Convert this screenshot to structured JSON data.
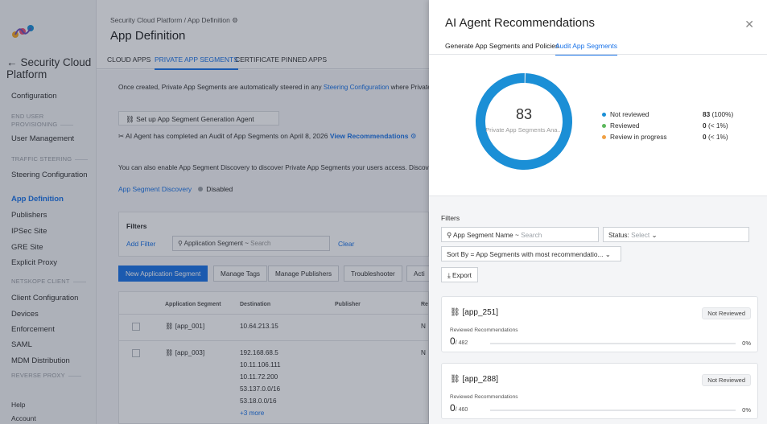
{
  "sidebar": {
    "back_label": "Security Cloud Platform",
    "items": [
      {
        "label": "Configuration",
        "type": "item"
      },
      {
        "label": "END USER PROVISIONING",
        "type": "section"
      },
      {
        "label": "User Management",
        "type": "item"
      },
      {
        "label": "TRAFFIC STEERING",
        "type": "section"
      },
      {
        "label": "Steering Configuration",
        "type": "item"
      },
      {
        "label": "App Definition",
        "type": "item",
        "active": true
      },
      {
        "label": "Publishers",
        "type": "item"
      },
      {
        "label": "IPSec Site",
        "type": "item"
      },
      {
        "label": "GRE Site",
        "type": "item"
      },
      {
        "label": "Explicit Proxy",
        "type": "item"
      },
      {
        "label": "NETSKOPE CLIENT",
        "type": "section"
      },
      {
        "label": "Client Configuration",
        "type": "item"
      },
      {
        "label": "Devices",
        "type": "item"
      },
      {
        "label": "Enforcement",
        "type": "item"
      },
      {
        "label": "SAML",
        "type": "item"
      },
      {
        "label": "MDM Distribution",
        "type": "item"
      },
      {
        "label": "REVERSE PROXY",
        "type": "section"
      }
    ],
    "help": "Help",
    "account": "Account"
  },
  "main": {
    "breadcrumb": "Security Cloud Platform / App Definition ⚙",
    "title": "App Definition",
    "tabs": [
      "CLOUD APPS",
      "PRIVATE APP SEGMENTS",
      "CERTIFICATE PINNED APPS"
    ],
    "intro_prefix": "Once created, Private App Segments are automatically steered in any ",
    "intro_link": "Steering Configuration",
    "intro_suffix": " where Private Ap",
    "agent_button": "Set up App Segment Generation Agent",
    "completed_text": "AI Agent has completed an Audit of App Segments on April 8, 2026",
    "view_recs": "View Recommendations",
    "discovery_text": "You can also enable App Segment Discovery to discover Private App Segments your users access. Discovered a",
    "discovery_link": "App Segment Discovery",
    "discovery_status": "Disabled",
    "filters_label": "Filters",
    "add_filter": "Add Filter",
    "search_field": "Application Segment ~",
    "search_placeholder": "Search",
    "clear": "Clear",
    "buttons": [
      "New Application Segment",
      "Manage Tags",
      "Manage Publishers",
      "Troubleshooter",
      "Acti"
    ],
    "table_headers": [
      "Application Segment",
      "Destination",
      "Publisher",
      "Re"
    ],
    "rows": [
      {
        "name": "[app_001]",
        "destinations": [
          "10.64.213.15"
        ],
        "re": "N"
      },
      {
        "name": "[app_003]",
        "destinations": [
          "192.168.68.5",
          "10.11.106.111",
          "10.11.72.200",
          "53.137.0.0/16",
          "53.18.0.0/16"
        ],
        "more": "+3 more",
        "re": "N"
      }
    ]
  },
  "panel": {
    "title": "AI Agent Recommendations",
    "tabs": [
      "Generate App Segments and Policies",
      "Audit App Segments"
    ],
    "donut_value": "83",
    "donut_caption": "Private App Segments Ana...",
    "legend": [
      {
        "label": "Not reviewed",
        "value": "83",
        "pct": "(100%)",
        "color": "#1b8fd6"
      },
      {
        "label": "Reviewed",
        "value": "0",
        "pct": "(< 1%)",
        "color": "#5cb85c"
      },
      {
        "label": "Review in progress",
        "value": "0",
        "pct": "(< 1%)",
        "color": "#f0a043"
      }
    ],
    "chart_data": {
      "type": "pie",
      "categories": [
        "Not reviewed",
        "Reviewed",
        "Review in progress"
      ],
      "values": [
        83,
        0,
        0
      ]
    },
    "filters_label": "Filters",
    "name_filter": "App Segment Name ~",
    "name_placeholder": "Search",
    "status_filter": "Status:",
    "status_value": "Select",
    "sort_label": "Sort By =",
    "sort_value": "App Segments with most recommendatio...",
    "export": "Export",
    "cards": [
      {
        "name": "[app_251]",
        "badge": "Not Reviewed",
        "sub": "Reviewed Recommendations",
        "count": "0",
        "total": "/ 482",
        "pct": "0%"
      },
      {
        "name": "[app_288]",
        "badge": "Not Reviewed",
        "sub": "Reviewed Recommendations",
        "count": "0",
        "total": "/ 460",
        "pct": "0%"
      }
    ]
  }
}
